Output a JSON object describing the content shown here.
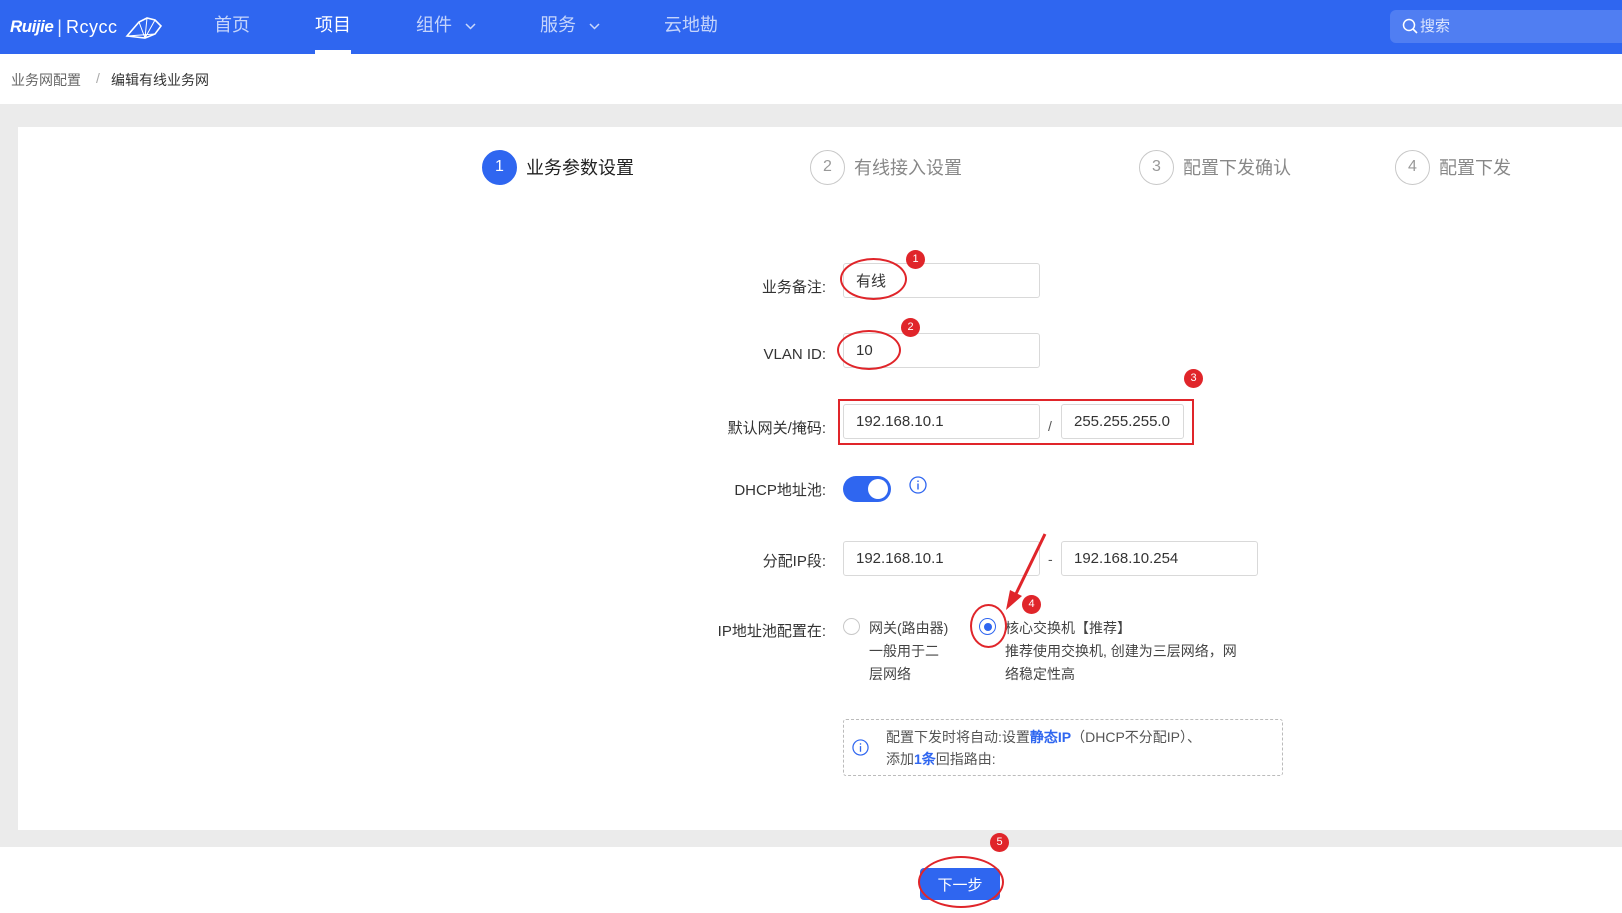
{
  "nav": {
    "logo_ruijie": "Ruijie",
    "logo_sep": "|",
    "logo_reyee": "Rcycc",
    "items": [
      "首页",
      "项目",
      "组件",
      "服务",
      "云地勘"
    ],
    "search_placeholder": "搜索"
  },
  "breadcrumb": {
    "parent": "业务网配置",
    "separator": "/",
    "current": "编辑有线业务网"
  },
  "steps": [
    {
      "num": "1",
      "label": "业务参数设置"
    },
    {
      "num": "2",
      "label": "有线接入设置"
    },
    {
      "num": "3",
      "label": "配置下发确认"
    },
    {
      "num": "4",
      "label": "配置下发"
    }
  ],
  "form": {
    "remark_label": "业务备注:",
    "remark_value": "有线",
    "vlan_label": "VLAN ID:",
    "vlan_value": "10",
    "gateway_label": "默认网关/掩码:",
    "gateway_value": "192.168.10.1",
    "mask_sep": "/",
    "mask_value": "255.255.255.0",
    "dhcp_label": "DHCP地址池:",
    "range_label": "分配IP段:",
    "range_start": "192.168.10.1",
    "range_sep": "-",
    "range_end": "192.168.10.254",
    "pool_label": "IP地址池配置在:",
    "option1_title": "网关(路由器)",
    "option1_desc_1": "一般用于二",
    "option1_desc_2": "层网络",
    "option2_title": "核心交换机【推荐】",
    "option2_desc_1": "推荐使用交换机, 创建为三层网络，网",
    "option2_desc_2": "络稳定性高"
  },
  "notice": {
    "p1": "配置下发时将自动:设置",
    "p1_hl": "静态IP",
    "p1_tail": "（DHCP不分配IP）、",
    "p2": "添加",
    "p2_hl": "1条",
    "p2_tail": "回指路由:"
  },
  "next_button": "下一步",
  "annotations": [
    "1",
    "2",
    "3",
    "4",
    "5"
  ],
  "colors": {
    "primary": "#2f66f0",
    "annotation": "#e0252a"
  }
}
